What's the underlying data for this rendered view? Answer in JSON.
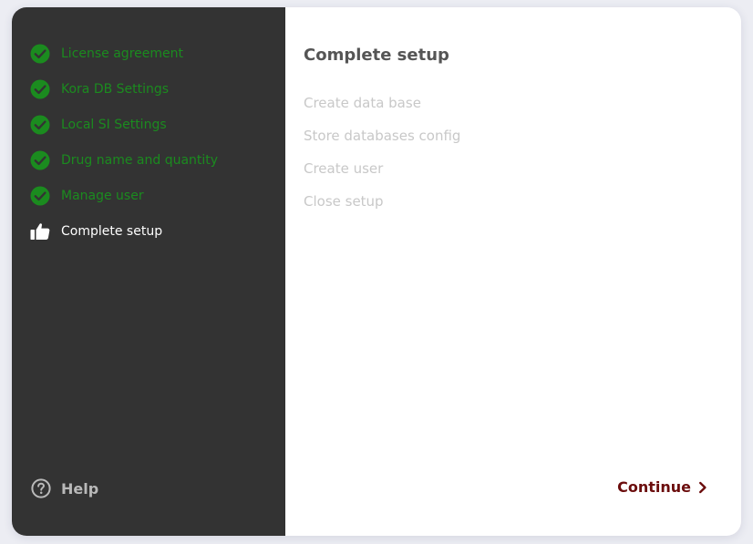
{
  "sidebar": {
    "steps": [
      {
        "label": "License agreement",
        "status": "done",
        "icon": "check-circle-icon"
      },
      {
        "label": "Kora DB Settings",
        "status": "done",
        "icon": "check-circle-icon"
      },
      {
        "label": "Local SI Settings",
        "status": "done",
        "icon": "check-circle-icon"
      },
      {
        "label": "Drug name and quantity",
        "status": "done",
        "icon": "check-circle-icon"
      },
      {
        "label": "Manage user",
        "status": "done",
        "icon": "check-circle-icon"
      },
      {
        "label": "Complete setup",
        "status": "current",
        "icon": "thumbs-up-icon"
      }
    ],
    "help_label": "Help"
  },
  "main": {
    "title": "Complete setup",
    "tasks": [
      "Create data base",
      "Store databases config",
      "Create user",
      "Close setup"
    ],
    "continue_label": "Continue"
  },
  "colors": {
    "sidebar_bg": "#333333",
    "step_done": "#1b8b1f",
    "step_current": "#ffffff",
    "accent_continue": "#6b0d0d",
    "task_pending": "#c8c8c8"
  }
}
